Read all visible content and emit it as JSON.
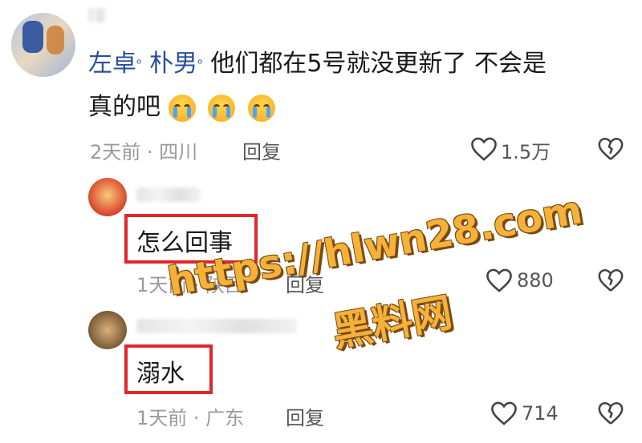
{
  "comment": {
    "mention1": "左卓",
    "mention2": "朴男",
    "text_line1": "他们都在5号就没更新了 不会是",
    "text_line2": "真的吧",
    "meta": "2天前 · 四川",
    "reply_label": "回复",
    "likes": "1.5万"
  },
  "replies": [
    {
      "text": "怎么回事",
      "meta": "1天前 · 陕西",
      "reply_label": "回复",
      "likes": "880"
    },
    {
      "text": "溺水",
      "meta": "1天前 · 广东",
      "reply_label": "回复",
      "likes": "714"
    }
  ],
  "watermark": {
    "url": "https://hlwn28.com",
    "name": "黑料网"
  },
  "colors": {
    "mention": "#2a4f9a",
    "highlight_box": "#e1262b",
    "watermark": "#f5b23a"
  }
}
